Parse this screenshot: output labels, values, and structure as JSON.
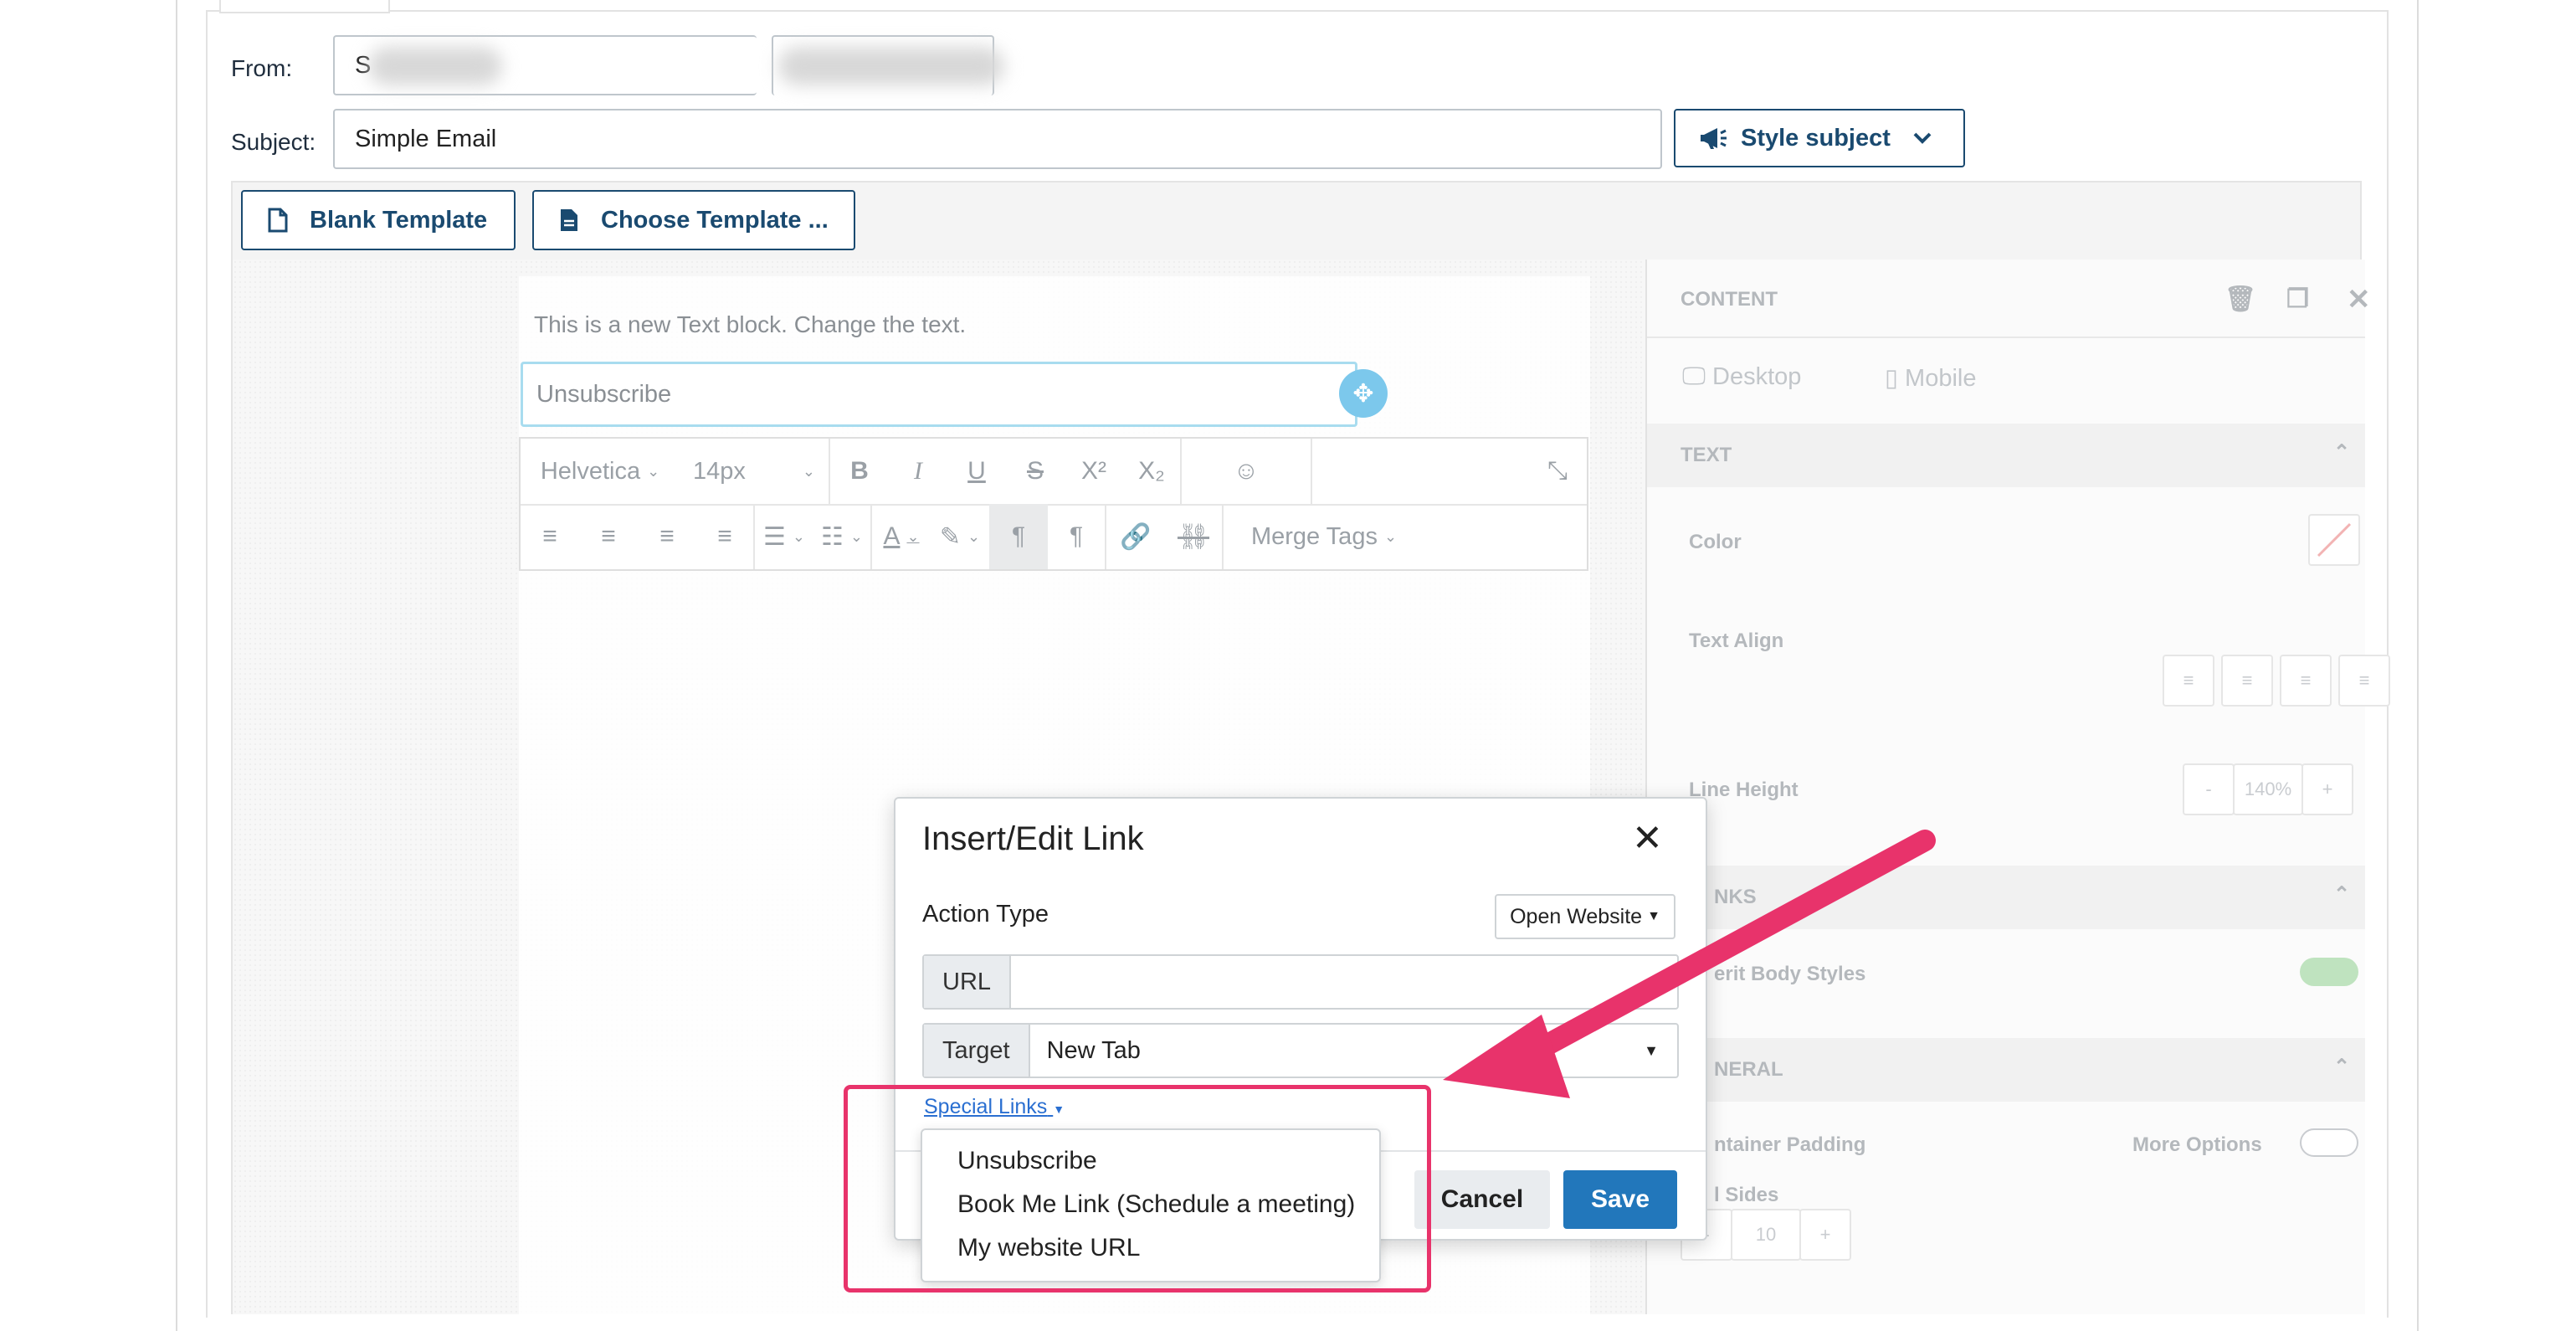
{
  "form": {
    "from_label": "From:",
    "from_value": "S",
    "subject_label": "Subject:",
    "subject_value": "Simple Email",
    "style_subject": "Style subject"
  },
  "templates": {
    "blank": "Blank Template",
    "choose": "Choose Template ..."
  },
  "editor": {
    "placeholder_text": "This is a new Text block. Change the text.",
    "selected_text": "Unsubscribe",
    "toolbar": {
      "font": "Helvetica",
      "size": "14px",
      "merge_tags": "Merge Tags"
    }
  },
  "sidebar": {
    "content": "CONTENT",
    "desktop": "Desktop",
    "mobile": "Mobile",
    "text_section": "TEXT",
    "color": "Color",
    "text_align": "Text Align",
    "line_height": "Line Height",
    "line_height_value": "140%",
    "minus": "-",
    "plus": "+",
    "links_section": "NKS",
    "inherit_body": "erit Body Styles",
    "general_section": "NERAL",
    "container_padding": "ntainer Padding",
    "more_options": "More Options",
    "all_sides": "l Sides",
    "padding_value": "10"
  },
  "dialog": {
    "title": "Insert/Edit Link",
    "action_type_label": "Action Type",
    "action_type_value": "Open Website",
    "url_label": "URL",
    "url_value": "",
    "target_label": "Target",
    "target_value": "New Tab",
    "special_links": "Special Links",
    "cancel": "Cancel",
    "save": "Save",
    "special_link_options": [
      "Unsubscribe",
      "Book Me Link (Schedule a meeting)",
      "My website URL"
    ]
  },
  "colors": {
    "primary": "#1a4a70",
    "save": "#2277bb",
    "annotation": "#e8336b"
  }
}
